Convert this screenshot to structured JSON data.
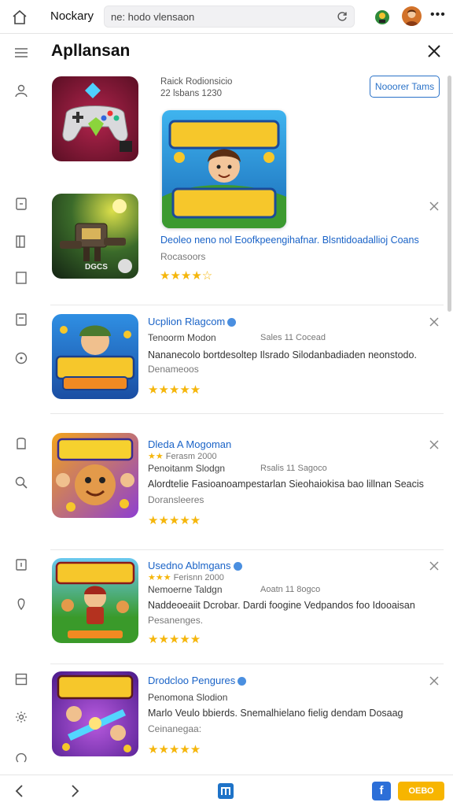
{
  "browser": {
    "brand": "Nockary",
    "url": "ne:  hodo vlensaon"
  },
  "header": {
    "title": "Apllansan",
    "follow_label": "Nooorer Tams"
  },
  "featured": {
    "meta_line1": "Raick Rodionsicio",
    "meta_line2": "22 lsbans 1230",
    "description": "Deoleo neno nol Eoofkpeengihafnar. Blsntidoadallioj Coans",
    "category": "Rocasoors",
    "rating": "★★★★☆"
  },
  "items": [
    {
      "name": "Ucplion Rlagcom",
      "subtitle": "Tenoorm Modon",
      "meta": "Sales 11 Cocead",
      "description": "Nananecolo bortdesoltep Ilsrado Silodanbadiaden neonstodo.",
      "category": "Denameoos",
      "rating": "★★★★★"
    },
    {
      "name": "Dleda A Mogoman",
      "meta_top": "Ferasm 2000",
      "subtitle": "Penoitanm Slodgn",
      "meta": "Rsalis 11 Sagoco",
      "description": "Alordtelie Fasioanoampestarlan Sieohaiokisa bao lillnan Seacis",
      "category": "Doransleeres",
      "rating": "★★★★★"
    },
    {
      "name": "Usedno Ablmgans",
      "meta_top": "Ferisnn 2000",
      "subtitle": "Nemoerne Taldgn",
      "meta": "Aoatn 11 8ogco",
      "description": "Naddeoeaiit Dcrobar. Dardi foogine Vedpandos foo Idooaisan",
      "category": "Pesanenges.",
      "rating": "★★★★★"
    },
    {
      "name": "Drodcloo Pengures",
      "subtitle": "Penomona Slodion",
      "description": "Marlo Veulo bbierds. Snemalhielano fielig dendam Dosaag",
      "category": "Ceinanegaa:",
      "rating": "★★★★★"
    }
  ],
  "bottom": {
    "fb_label": "f",
    "cta_label": "ОЕВО"
  },
  "colors": {
    "accent": "#1a63c7",
    "star": "#f5b60c",
    "cta": "#f7b500"
  }
}
